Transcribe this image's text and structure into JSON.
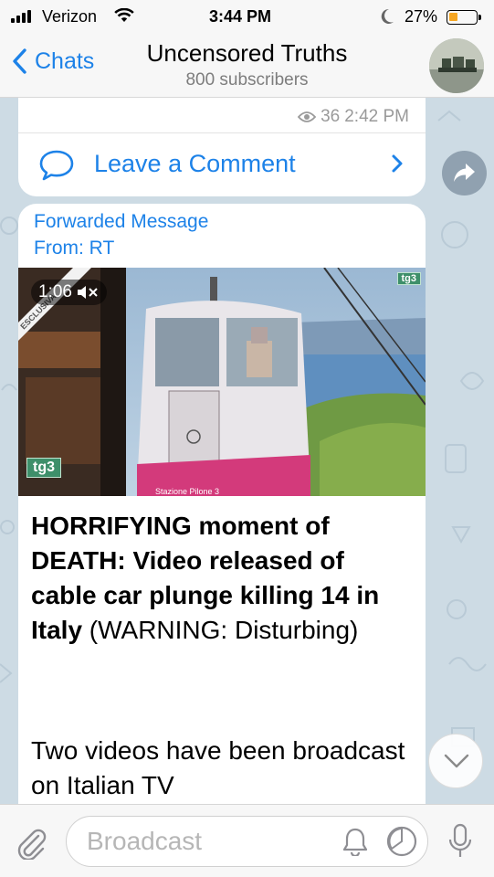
{
  "status_bar": {
    "carrier": "Verizon",
    "time": "3:44 PM",
    "battery_percent": "27%",
    "battery_level": 0.27
  },
  "nav": {
    "back_label": "Chats",
    "title": "Uncensored Truths",
    "subtitle": "800 subscribers"
  },
  "prev_message": {
    "views": "36",
    "time": "2:42 PM",
    "comment_label": "Leave a Comment"
  },
  "message": {
    "forwarded_label": "Forwarded Message",
    "from_label": "From: RT",
    "video": {
      "duration": "1:06",
      "badge_left": "tg3",
      "badge_right": "tg3",
      "corner_text": "ESCLUSIVA",
      "caption_text": "Stazione Pilone 3"
    },
    "headline_bold": "HORRIFYING moment of DEATH: Video released of cable car plunge killing 14 in Italy",
    "headline_rest": " (WARNING: Disturbing)",
    "body": "Two videos have been broadcast on Italian TV"
  },
  "composer": {
    "placeholder": "Broadcast"
  },
  "icons": {
    "back": "chevron-left-icon",
    "views": "eye-icon",
    "comment": "speech-bubble-icon",
    "share": "share-arrow-icon",
    "scroll": "chevron-down-icon",
    "attach": "paperclip-icon",
    "bell": "bell-icon",
    "timer": "timer-icon",
    "mic": "microphone-icon"
  },
  "colors": {
    "accent": "#1d82e8",
    "bubble": "#ffffff",
    "wallpaper": "#cddbe4",
    "battery": "#f5a623"
  }
}
